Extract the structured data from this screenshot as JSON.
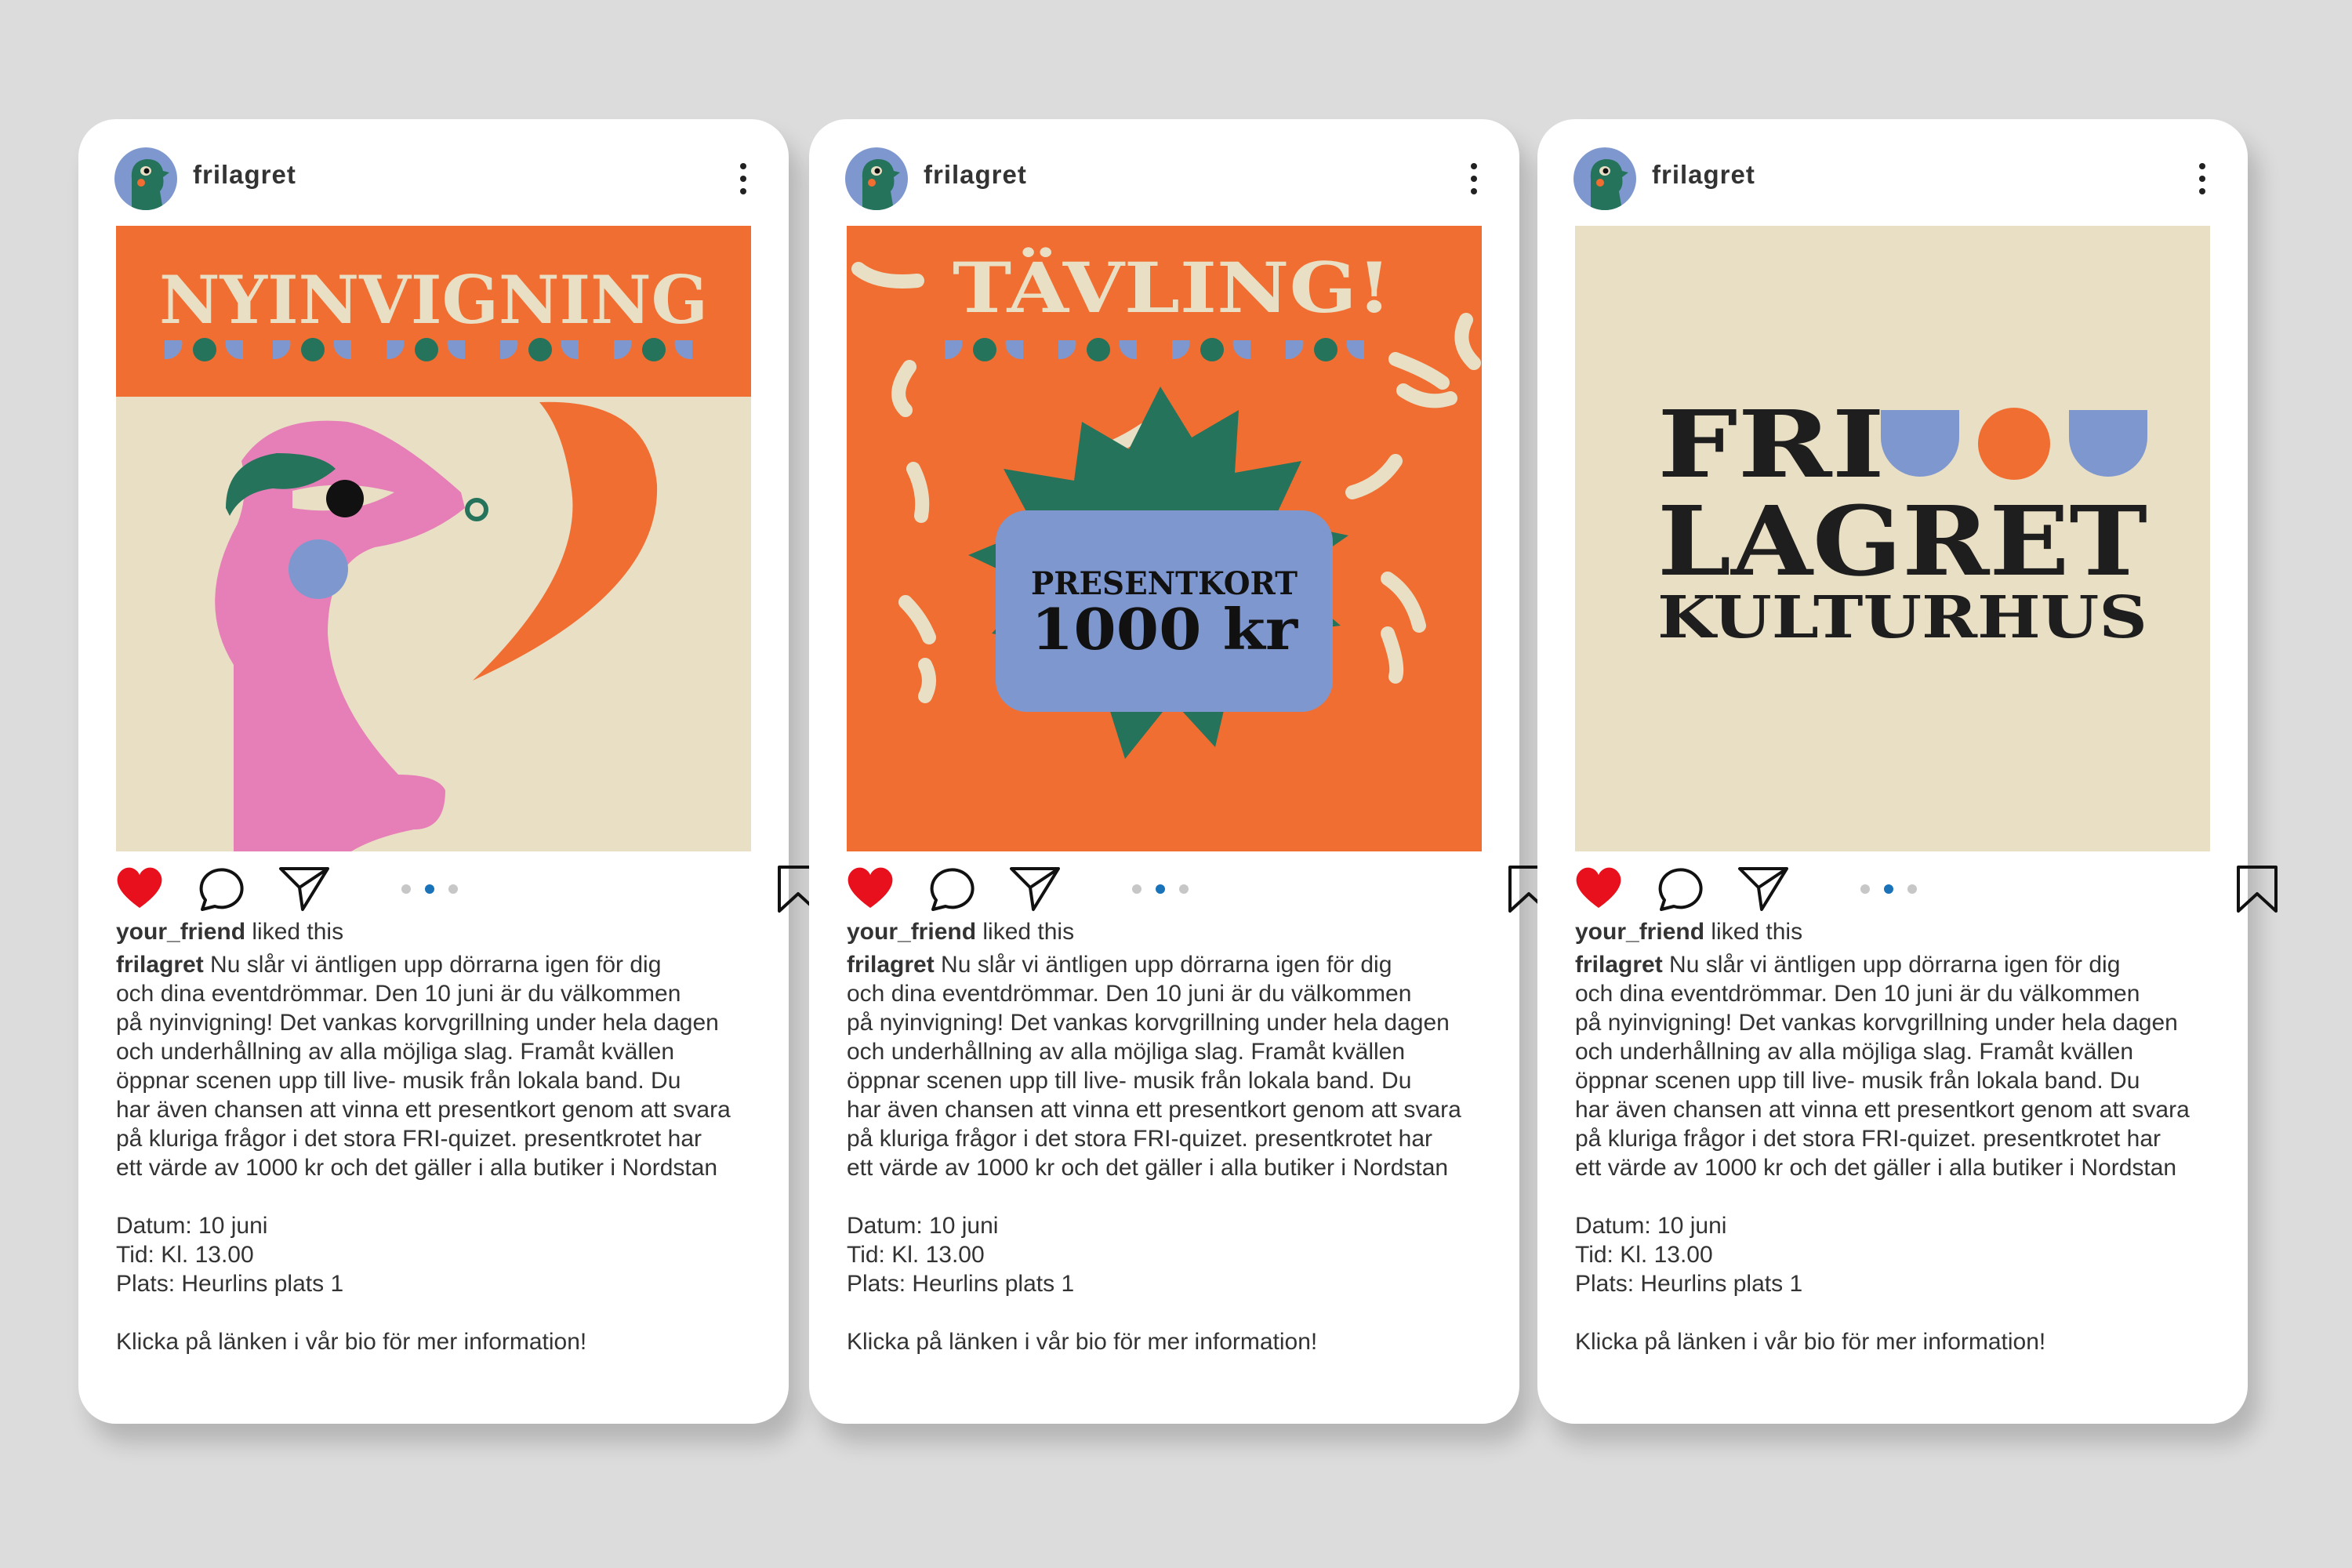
{
  "account": {
    "username": "frilagret"
  },
  "engagement": {
    "liker": "your_friend",
    "liked_text": "liked this"
  },
  "caption": {
    "author": "frilagret",
    "lines": [
      "Nu slår vi äntligen upp dörrarna igen för dig",
      "och dina eventdrömmar. Den 10 juni är du välkommen",
      "på nyinvigning! Det vankas korvgrillning under hela dagen",
      "och underhållning av alla möjliga slag. Framåt kvällen",
      "öppnar scenen upp till live- musik från lokala band. Du",
      "har även chansen att vinna ett presentkort genom att svara",
      "på kluriga frågor i det stora FRI-quizet. presentkrotet har",
      "ett värde av 1000 kr och det gäller i alla butiker i Nordstan"
    ],
    "details": [
      "Datum: 10 juni",
      "Tid: Kl. 13.00",
      "Plats: Heurlins plats 1"
    ],
    "cta": "Klicka på länken i vår bio för mer information!"
  },
  "posts": [
    {
      "image": {
        "title": "NYINVIGNING"
      },
      "carousel": {
        "count": 3,
        "active": 1
      }
    },
    {
      "image": {
        "title": "TÄVLING!",
        "card_line1": "PRESENTKORT",
        "card_line2": "1000 kr"
      },
      "carousel": {
        "count": 3,
        "active": 1
      }
    },
    {
      "image": {
        "line1": "FRI",
        "line2": "LAGRET",
        "line3": "KULTURHUS"
      },
      "carousel": {
        "count": 3,
        "active": 1
      }
    }
  ],
  "colors": {
    "background": "#dcdcdc",
    "orange": "#f06e32",
    "cream": "#e9dfc4",
    "pink": "#e67eb7",
    "green": "#24735a",
    "periwinkle": "#7e98cf",
    "dark": "#1e1e1e",
    "heart_red": "#e8101c",
    "dot_active": "#1a72b9",
    "dot_inactive": "#c7c7c7"
  },
  "icons": [
    "heart-icon",
    "comment-icon",
    "share-icon",
    "bookmark-icon",
    "more-icon"
  ]
}
